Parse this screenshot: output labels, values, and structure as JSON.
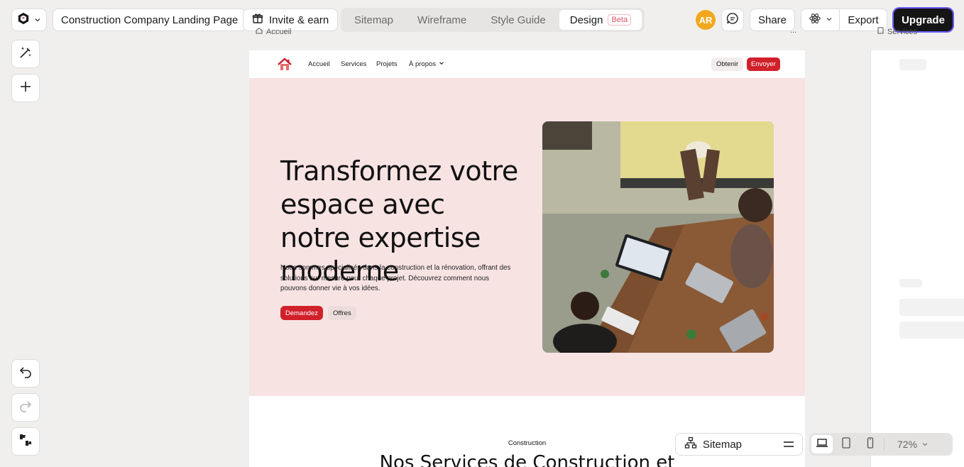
{
  "topbar": {
    "project_title": "Construction Company Landing Page",
    "invite_label": "Invite & earn",
    "tabs": [
      {
        "label": "Sitemap"
      },
      {
        "label": "Wireframe"
      },
      {
        "label": "Style Guide"
      },
      {
        "label": "Design",
        "badge": "Beta"
      }
    ],
    "avatar_initials": "AR",
    "share_label": "Share",
    "export_label": "Export",
    "upgrade_label": "Upgrade"
  },
  "canvas": {
    "frame_label": "Accueil",
    "frame_more": "...",
    "frame2_label": "Services"
  },
  "site": {
    "nav": {
      "links": [
        "Accueil",
        "Services",
        "Projets",
        "À propos"
      ],
      "obtenir": "Obtenir",
      "envoyer": "Envoyer"
    },
    "hero": {
      "title": "Transformez votre espace avec notre expertise moderne",
      "description": "Nous sommes spécialisés dans la construction et la rénovation, offrant des solutions sur mesure pour chaque projet. Découvrez comment nous pouvons donner vie à vos idées.",
      "primary_cta": "Demandez",
      "secondary_cta": "Offres"
    },
    "section": {
      "kicker": "Construction",
      "title": "Nos Services de Construction et"
    }
  },
  "bottombar": {
    "sitemap_label": "Sitemap",
    "zoom": "72%"
  },
  "colors": {
    "accent_red": "#d0212b",
    "hero_bg": "#f8e3e3",
    "upgrade_bg": "#151515",
    "avatar": "#f2a81d"
  }
}
